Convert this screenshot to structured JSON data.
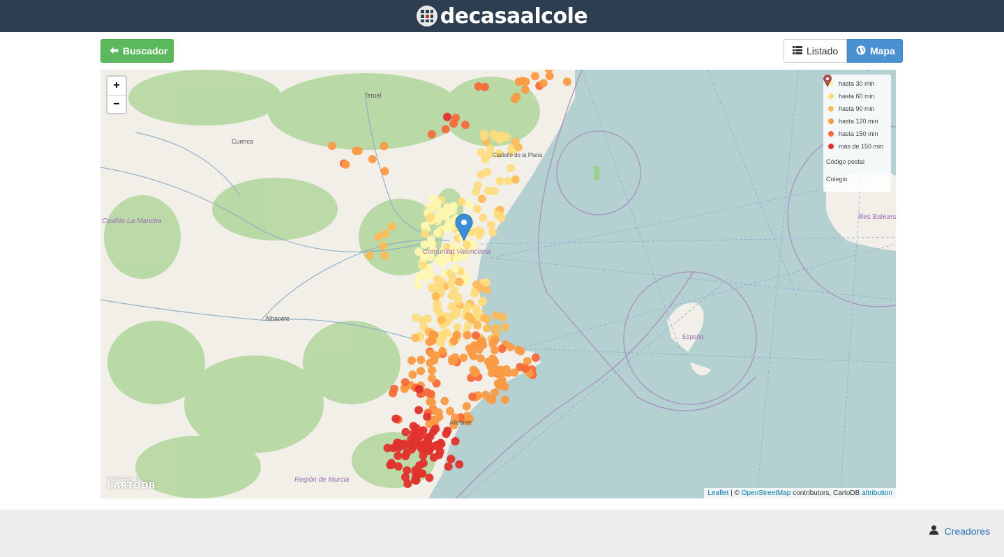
{
  "header": {
    "brand": "decasaalcole"
  },
  "nav": {
    "back_label": "Buscador",
    "list_label": "Listado",
    "map_label": "Mapa"
  },
  "map": {
    "places": [
      {
        "name": "Teruel"
      },
      {
        "name": "Cuenca"
      },
      {
        "name": "Castilla-La Mancha"
      },
      {
        "name": "Albacete"
      },
      {
        "name": "Región de Murcia"
      },
      {
        "name": "Comunitat Valenciana"
      },
      {
        "name": "Castelló de la Plana"
      },
      {
        "name": "España"
      },
      {
        "name": "Illes Balears"
      },
      {
        "name": "Alicante"
      }
    ],
    "zoom_in": "+",
    "zoom_out": "−",
    "legend": [
      {
        "label": "hasta 30 min",
        "color": "#fff7b0"
      },
      {
        "label": "hasta 60 min",
        "color": "#fddc7e"
      },
      {
        "label": "hasta 90 min",
        "color": "#fcba5a"
      },
      {
        "label": "hasta 120 min",
        "color": "#fb9a45"
      },
      {
        "label": "hasta 150 min",
        "color": "#f76b3a"
      },
      {
        "label": "más de 150 min",
        "color": "#e0322c"
      }
    ],
    "pin_legend": [
      {
        "label": "Código postal",
        "color": "#3d8ed8"
      },
      {
        "label": "Colegio",
        "color": "#a8504c"
      }
    ],
    "attribution": {
      "leaflet": "Leaflet",
      "sep": " | © ",
      "osm": "OpenStreetMap",
      "rest": " contributors, CartoDB ",
      "link": "attribution"
    },
    "cartodb_small": "POWERED BY",
    "cartodb": "CARTODB"
  },
  "footer": {
    "creators_label": "Creadores"
  }
}
